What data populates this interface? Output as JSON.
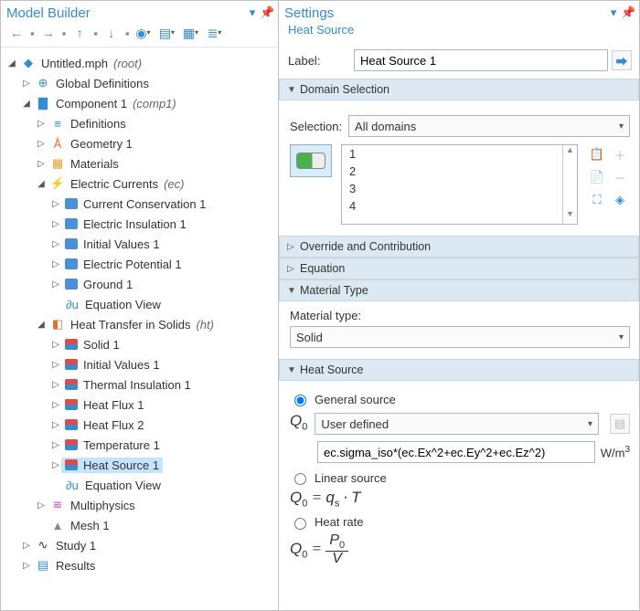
{
  "left": {
    "title": "Model Builder",
    "toolbar_buttons": [
      "back",
      "forward",
      "up",
      "down",
      "eye",
      "outline",
      "outline2",
      "outline3"
    ],
    "tree": [
      {
        "depth": 0,
        "tw": "exp",
        "icon": "root",
        "label": "Untitled.mph",
        "tag": " (root)"
      },
      {
        "depth": 1,
        "tw": "col",
        "icon": "globe",
        "label": "Global Definitions"
      },
      {
        "depth": 1,
        "tw": "exp",
        "icon": "comp",
        "label": "Component 1",
        "tag": " (comp1)"
      },
      {
        "depth": 2,
        "tw": "col",
        "icon": "def",
        "label": "Definitions"
      },
      {
        "depth": 2,
        "tw": "col",
        "icon": "geom",
        "label": "Geometry 1"
      },
      {
        "depth": 2,
        "tw": "col",
        "icon": "mat",
        "label": "Materials"
      },
      {
        "depth": 2,
        "tw": "exp",
        "icon": "phys",
        "label": "Electric Currents",
        "tag": " (ec)"
      },
      {
        "depth": 3,
        "tw": "col",
        "icon": "feat",
        "label": "Current Conservation 1"
      },
      {
        "depth": 3,
        "tw": "col",
        "icon": "feat",
        "label": "Electric Insulation 1"
      },
      {
        "depth": 3,
        "tw": "col",
        "icon": "feat",
        "label": "Initial Values 1"
      },
      {
        "depth": 3,
        "tw": "col",
        "icon": "feat",
        "label": "Electric Potential 1"
      },
      {
        "depth": 3,
        "tw": "col",
        "icon": "feat",
        "label": "Ground 1"
      },
      {
        "depth": 3,
        "tw": "",
        "icon": "eqv",
        "label": "Equation View"
      },
      {
        "depth": 2,
        "tw": "exp",
        "icon": "ht",
        "label": "Heat Transfer in Solids",
        "tag": " (ht)"
      },
      {
        "depth": 3,
        "tw": "col",
        "icon": "htfeat",
        "label": "Solid 1"
      },
      {
        "depth": 3,
        "tw": "col",
        "icon": "htfeat",
        "label": "Initial Values 1"
      },
      {
        "depth": 3,
        "tw": "col",
        "icon": "htfeat",
        "label": "Thermal Insulation 1"
      },
      {
        "depth": 3,
        "tw": "col",
        "icon": "htfeat",
        "label": "Heat Flux 1"
      },
      {
        "depth": 3,
        "tw": "col",
        "icon": "htfeat",
        "label": "Heat Flux 2"
      },
      {
        "depth": 3,
        "tw": "col",
        "icon": "htfeat",
        "label": "Temperature 1"
      },
      {
        "depth": 3,
        "tw": "col",
        "icon": "htfeat",
        "label": "Heat Source 1",
        "selected": true
      },
      {
        "depth": 3,
        "tw": "",
        "icon": "eqv",
        "label": "Equation View"
      },
      {
        "depth": 2,
        "tw": "col",
        "icon": "waves",
        "label": "Multiphysics"
      },
      {
        "depth": 2,
        "tw": "",
        "icon": "mesh",
        "label": "Mesh 1"
      },
      {
        "depth": 1,
        "tw": "col",
        "icon": "study",
        "label": "Study 1"
      },
      {
        "depth": 1,
        "tw": "col",
        "icon": "tbl",
        "label": "Results"
      }
    ]
  },
  "right": {
    "title": "Settings",
    "subtitle": "Heat Source",
    "label_text": "Label:",
    "label_value": "Heat Source 1",
    "sections": {
      "domain_title": "Domain Selection",
      "selection_label": "Selection:",
      "selection_value": "All domains",
      "domains": [
        "1",
        "2",
        "3",
        "4"
      ],
      "override_title": "Override and Contribution",
      "equation_title": "Equation",
      "material_type_title": "Material Type",
      "material_type_label": "Material type:",
      "material_type_value": "Solid",
      "heat_source_title": "Heat Source",
      "radio_general": "General source",
      "q0_mode": "User defined",
      "q0_expr": "ec.sigma_iso*(ec.Ex^2+ec.Ey^2+ec.Ez^2)",
      "q0_unit_html": "W/m³",
      "radio_linear": "Linear source",
      "radio_heatrate": "Heat rate"
    }
  }
}
